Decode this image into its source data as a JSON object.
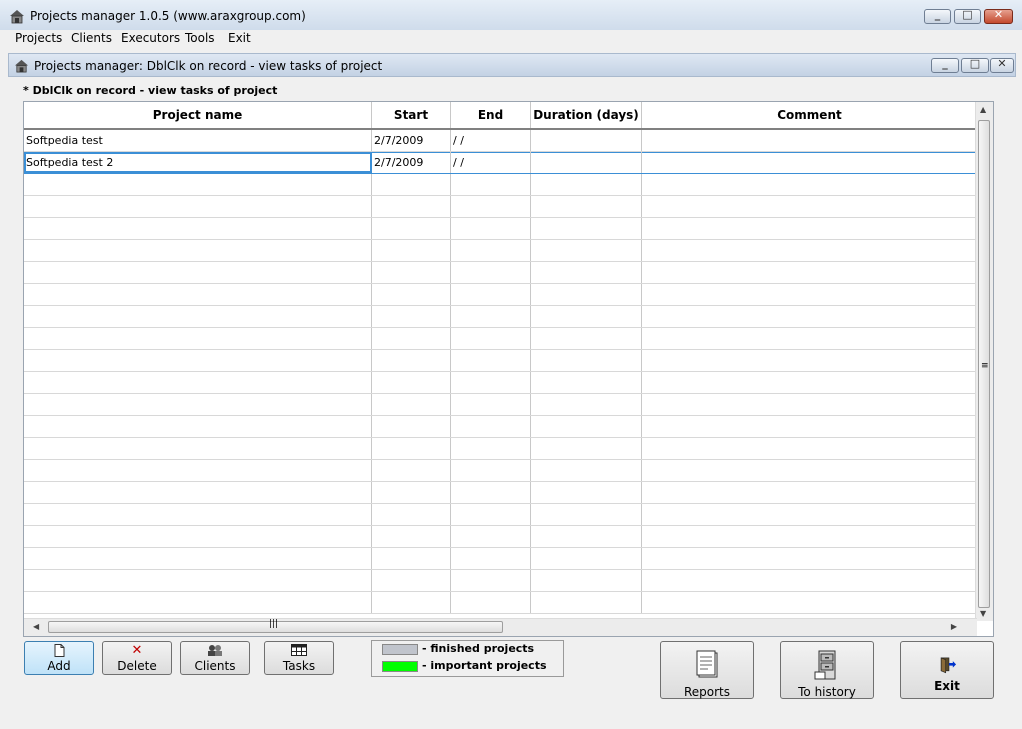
{
  "window": {
    "title": "Projects manager 1.0.5 (www.araxgroup.com)",
    "controls": {
      "minimize": "_",
      "maximize": "□",
      "close": "✕"
    }
  },
  "menu": [
    "Projects",
    "Clients",
    "Executors",
    "Tools",
    "Exit"
  ],
  "child_window": {
    "title": "Projects manager: DblClk on record - view tasks of project"
  },
  "hint": "* DblClk on record - view tasks of project",
  "grid": {
    "columns": [
      "Project name",
      "Start",
      "End",
      "Duration (days)",
      "Comment"
    ],
    "rows": [
      {
        "project_name": "Softpedia test",
        "start": "2/7/2009",
        "end": " /  /",
        "duration": "",
        "comment": ""
      },
      {
        "project_name": "Softpedia test 2",
        "start": "2/7/2009",
        "end": " /  /",
        "duration": "",
        "comment": ""
      }
    ],
    "selected_row": 1
  },
  "buttons": {
    "add": "Add",
    "delete": "Delete",
    "clients": "Clients",
    "tasks": "Tasks",
    "reports": "Reports",
    "to_history": "To history",
    "exit": "Exit"
  },
  "legend": {
    "finished": {
      "label": "- finished projects",
      "color": "#c0c4cc"
    },
    "important": {
      "label": "- important projects",
      "color": "#00ff00"
    }
  },
  "colors": {
    "selection_border": "#3b8fd6",
    "delete_icon": "#c00000"
  }
}
